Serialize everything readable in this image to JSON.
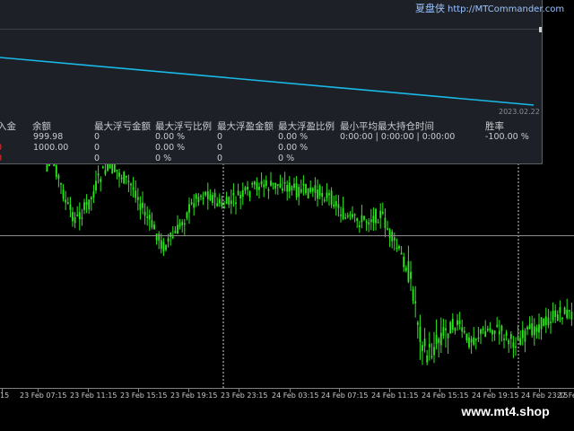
{
  "header": {
    "brand_cn": "夏盘侠",
    "brand_url": "http://MTCommander.com"
  },
  "equity": {
    "date_label": "2023.02.22",
    "line_color": "#19b9e8",
    "start_value": 1000.0,
    "end_value": 999.98
  },
  "stats_table": {
    "headers": [
      "入金",
      "余额",
      "最大浮亏金额",
      "最大浮亏比例",
      "最大浮盈金额",
      "最大浮盈比例",
      "最小平均最大持仓时间",
      "胜率"
    ],
    "rows": [
      [
        "0",
        "999.98",
        "0",
        "0.00 %",
        "0",
        "0.00 %",
        "0:00:00 | 0:00:00 | 0:00:00",
        "-100.00 %"
      ],
      [
        "0",
        "1000.00",
        "0",
        "0.00 %",
        "0",
        "0.00 %",
        "",
        ""
      ],
      [
        "0",
        "",
        "0",
        "0 %",
        "0",
        "0 %",
        "",
        ""
      ]
    ]
  },
  "time_axis": {
    "labels": [
      "15",
      "23 Feb 07:15",
      "23 Feb 11:15",
      "23 Feb 15:15",
      "23 Feb 19:15",
      "23 Feb 23:15",
      "24 Feb 03:15",
      "24 Feb 07:15",
      "24 Feb 11:15",
      "24 Feb 15:15",
      "24 Feb 19:15",
      "24 Feb 23:15",
      "27 Fe"
    ]
  },
  "colors": {
    "candle_body": "#2de81d",
    "candle_wick": "#2de81d",
    "background": "#000000",
    "panel_bg": "#1d2127",
    "accent_red": "#ff2a2a"
  },
  "watermark": "www.mt4.shop"
}
